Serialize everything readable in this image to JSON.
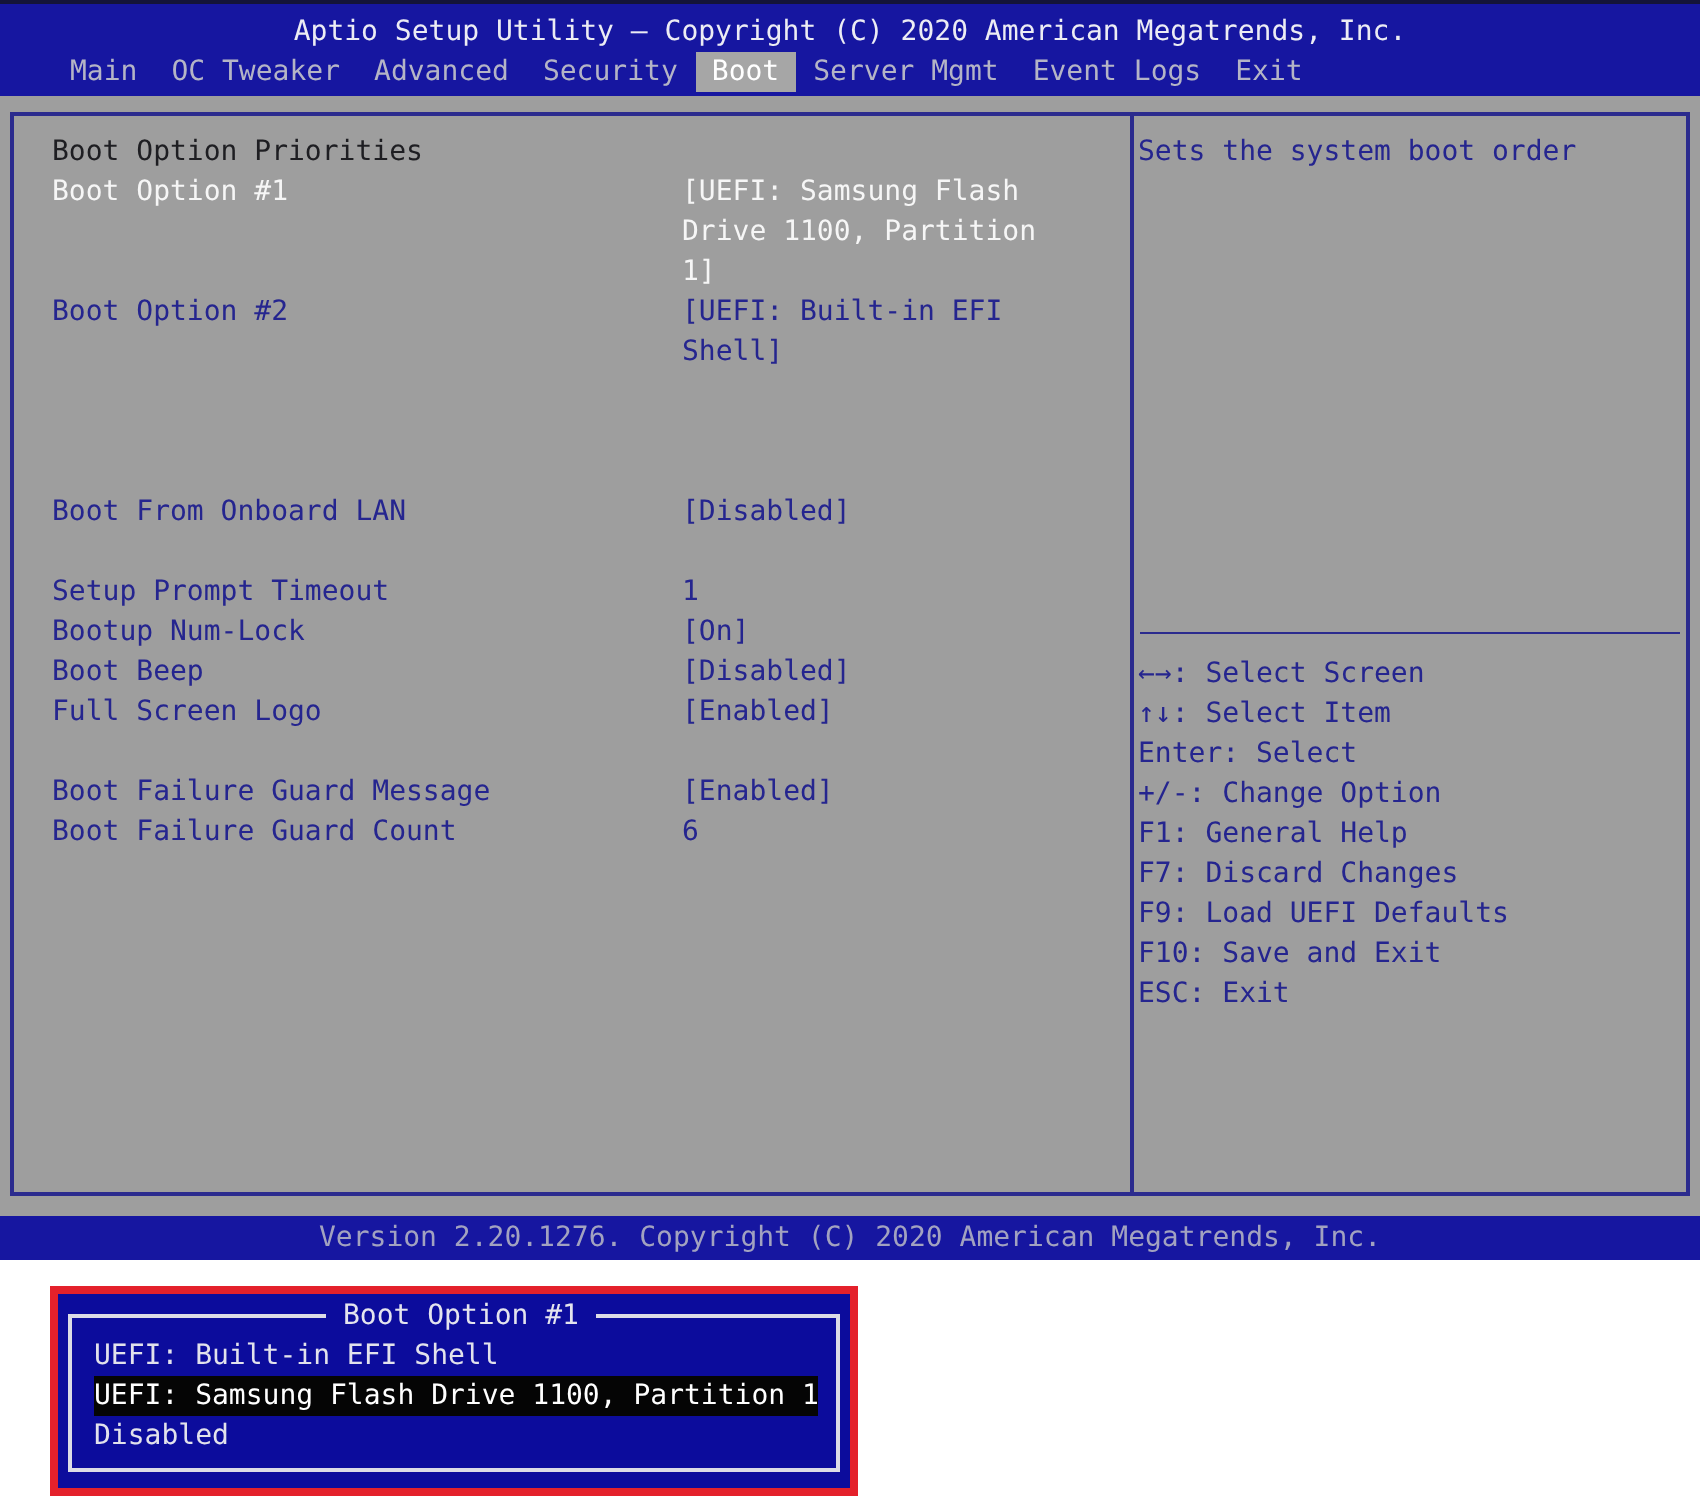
{
  "header": {
    "title": "Aptio Setup Utility – Copyright (C) 2020 American Megatrends, Inc.",
    "tabs": [
      {
        "label": "Main",
        "selected": false
      },
      {
        "label": "OC Tweaker",
        "selected": false
      },
      {
        "label": "Advanced",
        "selected": false
      },
      {
        "label": "Security",
        "selected": false
      },
      {
        "label": "Boot",
        "selected": true
      },
      {
        "label": "Server Mgmt",
        "selected": false
      },
      {
        "label": "Event Logs",
        "selected": false
      },
      {
        "label": "Exit",
        "selected": false
      }
    ]
  },
  "settings": {
    "sections": [
      {
        "kind": "priorities",
        "items": [
          {
            "kind": "heading",
            "label": "Boot Option Priorities"
          },
          {
            "kind": "option",
            "label": "Boot Option #1",
            "value": "[UEFI: Samsung Flash Drive 1100, Partition 1]",
            "selected": true
          },
          {
            "kind": "option",
            "label": "Boot Option #2",
            "value": "[UEFI: Built-in EFI Shell]",
            "selected": false
          }
        ]
      },
      {
        "kind": "group",
        "items": [
          {
            "kind": "option",
            "label": "Boot From Onboard LAN",
            "value": "[Disabled]",
            "selected": false
          }
        ]
      },
      {
        "kind": "group",
        "items": [
          {
            "kind": "option",
            "label": "Setup Prompt Timeout",
            "value": "1",
            "selected": false
          },
          {
            "kind": "option",
            "label": "Bootup Num-Lock",
            "value": "[On]",
            "selected": false
          },
          {
            "kind": "option",
            "label": "Boot Beep",
            "value": "[Disabled]",
            "selected": false
          },
          {
            "kind": "option",
            "label": "Full Screen Logo",
            "value": "[Enabled]",
            "selected": false
          }
        ]
      },
      {
        "kind": "group",
        "items": [
          {
            "kind": "option",
            "label": "Boot Failure Guard Message",
            "value": "[Enabled]",
            "selected": false
          },
          {
            "kind": "option",
            "label": "Boot Failure Guard Count",
            "value": "6",
            "selected": false
          }
        ]
      }
    ]
  },
  "help_panel": {
    "description": "Sets the system boot order",
    "key_hints": [
      "←→: Select Screen",
      "↑↓: Select Item",
      "Enter: Select",
      "+/-: Change Option",
      "F1: General Help",
      "F7: Discard Changes",
      "F9: Load UEFI Defaults",
      "F10: Save and Exit",
      "ESC: Exit"
    ]
  },
  "status_bar": {
    "text": "Version 2.20.1276. Copyright (C) 2020 American Megatrends, Inc."
  },
  "popup": {
    "title": "Boot Option #1",
    "options": [
      {
        "label": "UEFI: Built-in EFI Shell",
        "selected": false
      },
      {
        "label": "UEFI: Samsung Flash Drive 1100, Partition 1",
        "selected": true
      },
      {
        "label": "Disabled",
        "selected": false
      }
    ]
  }
}
